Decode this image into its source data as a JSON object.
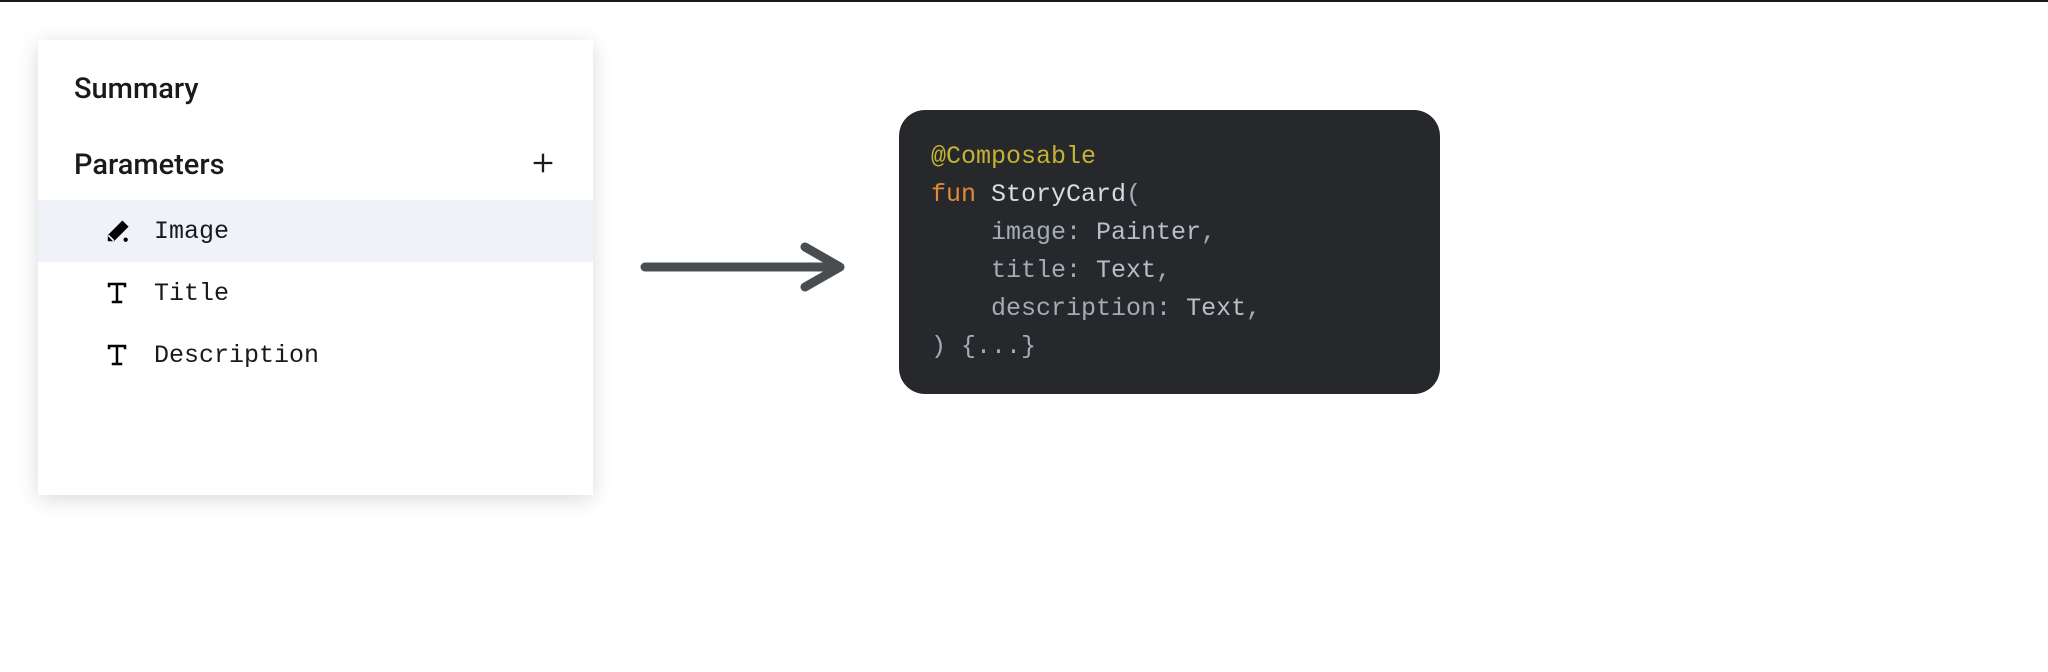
{
  "panel": {
    "summary_heading": "Summary",
    "parameters_heading": "Parameters",
    "items": [
      {
        "label": "Image",
        "icon": "image-fill-icon",
        "selected": true
      },
      {
        "label": "Title",
        "icon": "text-icon",
        "selected": false
      },
      {
        "label": "Description",
        "icon": "text-icon",
        "selected": false
      }
    ]
  },
  "code": {
    "annotation": "@Composable",
    "keyword": "fun",
    "function_name": "StoryCard",
    "open_paren": "(",
    "params": [
      {
        "name": "image",
        "type": "Painter"
      },
      {
        "name": "title",
        "type": "Text"
      },
      {
        "name": "description",
        "type": "Text"
      }
    ],
    "close": ") {...}",
    "indent": "    "
  }
}
